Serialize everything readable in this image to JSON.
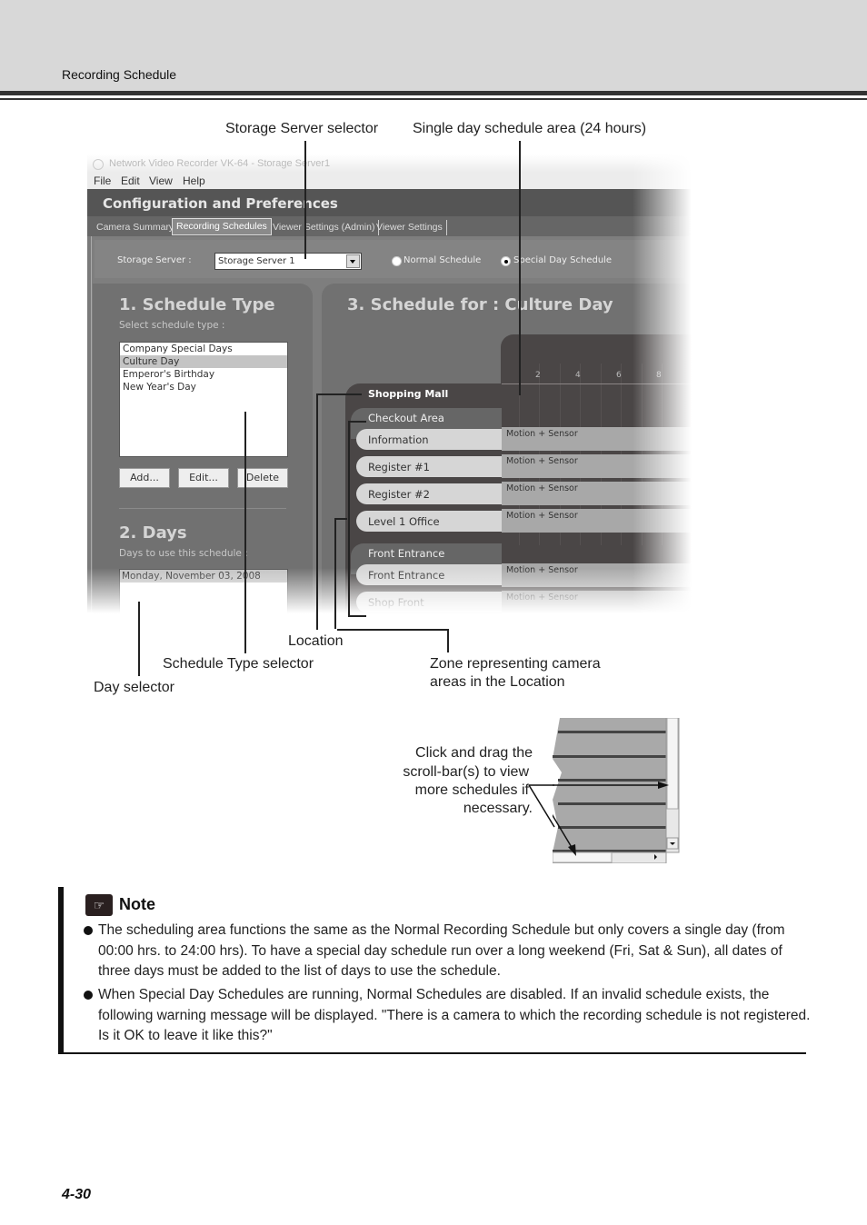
{
  "header": {
    "section_title": "Recording Schedule"
  },
  "callouts": {
    "storage_server_selector": "Storage Server selector",
    "single_day_area": "Single day schedule area (24 hours)",
    "location": "Location",
    "schedule_type_selector": "Schedule Type selector",
    "day_selector": "Day selector",
    "zone_line1": "Zone representing camera",
    "zone_line2": "areas in the Location",
    "scroll_line1": "Click and drag the",
    "scroll_line2": "scroll-bar(s) to view",
    "scroll_line3": "more schedules if",
    "scroll_line4": "necessary."
  },
  "app": {
    "window_title": "Network Video Recorder VK-64 - Storage Server1",
    "menu": [
      "File",
      "Edit",
      "View",
      "Help"
    ],
    "config_title": "Configuration and Preferences",
    "tabs": [
      {
        "label": "Camera Summary",
        "active": false
      },
      {
        "label": "Recording Schedules",
        "active": true
      },
      {
        "label": "Viewer Settings (Admin)",
        "active": false
      },
      {
        "label": "Viewer Settings",
        "active": false
      }
    ],
    "storage_server_label": "Storage Server :",
    "storage_server_value": "Storage Server 1",
    "radio_normal": "Normal Schedule",
    "radio_special": "Special Day Schedule",
    "selected_radio": "Special Day Schedule",
    "section1_title": "1. Schedule Type",
    "section1_sub": "Select schedule type :",
    "schedule_types": [
      "Company Special Days",
      "Culture Day",
      "Emperor's Birthday",
      "New Year's Day"
    ],
    "selected_schedule_type": "Culture Day",
    "buttons": {
      "add": "Add...",
      "edit": "Edit...",
      "delete": "Delete"
    },
    "section2_title": "2. Days",
    "section2_sub": "Days to use this schedule :",
    "days": [
      "Monday, November 03, 2008"
    ],
    "section3_title": "3. Schedule for : Culture Day",
    "hours": [
      "2",
      "4",
      "6",
      "8"
    ],
    "locations": [
      {
        "name": "Shopping Mall",
        "zones": [
          {
            "name": "Checkout Area",
            "cameras": [
              {
                "name": "Information",
                "mode": "Motion + Sensor"
              },
              {
                "name": "Register #1",
                "mode": "Motion + Sensor"
              },
              {
                "name": "Register #2",
                "mode": "Motion + Sensor"
              },
              {
                "name": "Level 1 Office",
                "mode": "Motion + Sensor"
              }
            ]
          },
          {
            "name": "Front Entrance",
            "cameras": [
              {
                "name": "Front Entrance",
                "mode": "Motion + Sensor"
              },
              {
                "name": "Shop Front",
                "mode": "Motion + Sensor"
              }
            ]
          }
        ]
      }
    ]
  },
  "note": {
    "title": "Note",
    "bullets": [
      "The scheduling area functions the same as the Normal Recording Schedule but only covers a single day (from 00:00 hrs. to 24:00 hrs). To have a special day schedule run over a long weekend (Fri, Sat & Sun), all dates of three days must be added to the list of days to use the schedule.",
      "When Special Day Schedules are running, Normal Schedules are disabled. If an invalid schedule exists, the following warning message will be displayed. \"There is a camera to which the recording schedule is not registered. Is it OK to leave it like this?\""
    ]
  },
  "footer": {
    "page_number": "4-30"
  }
}
